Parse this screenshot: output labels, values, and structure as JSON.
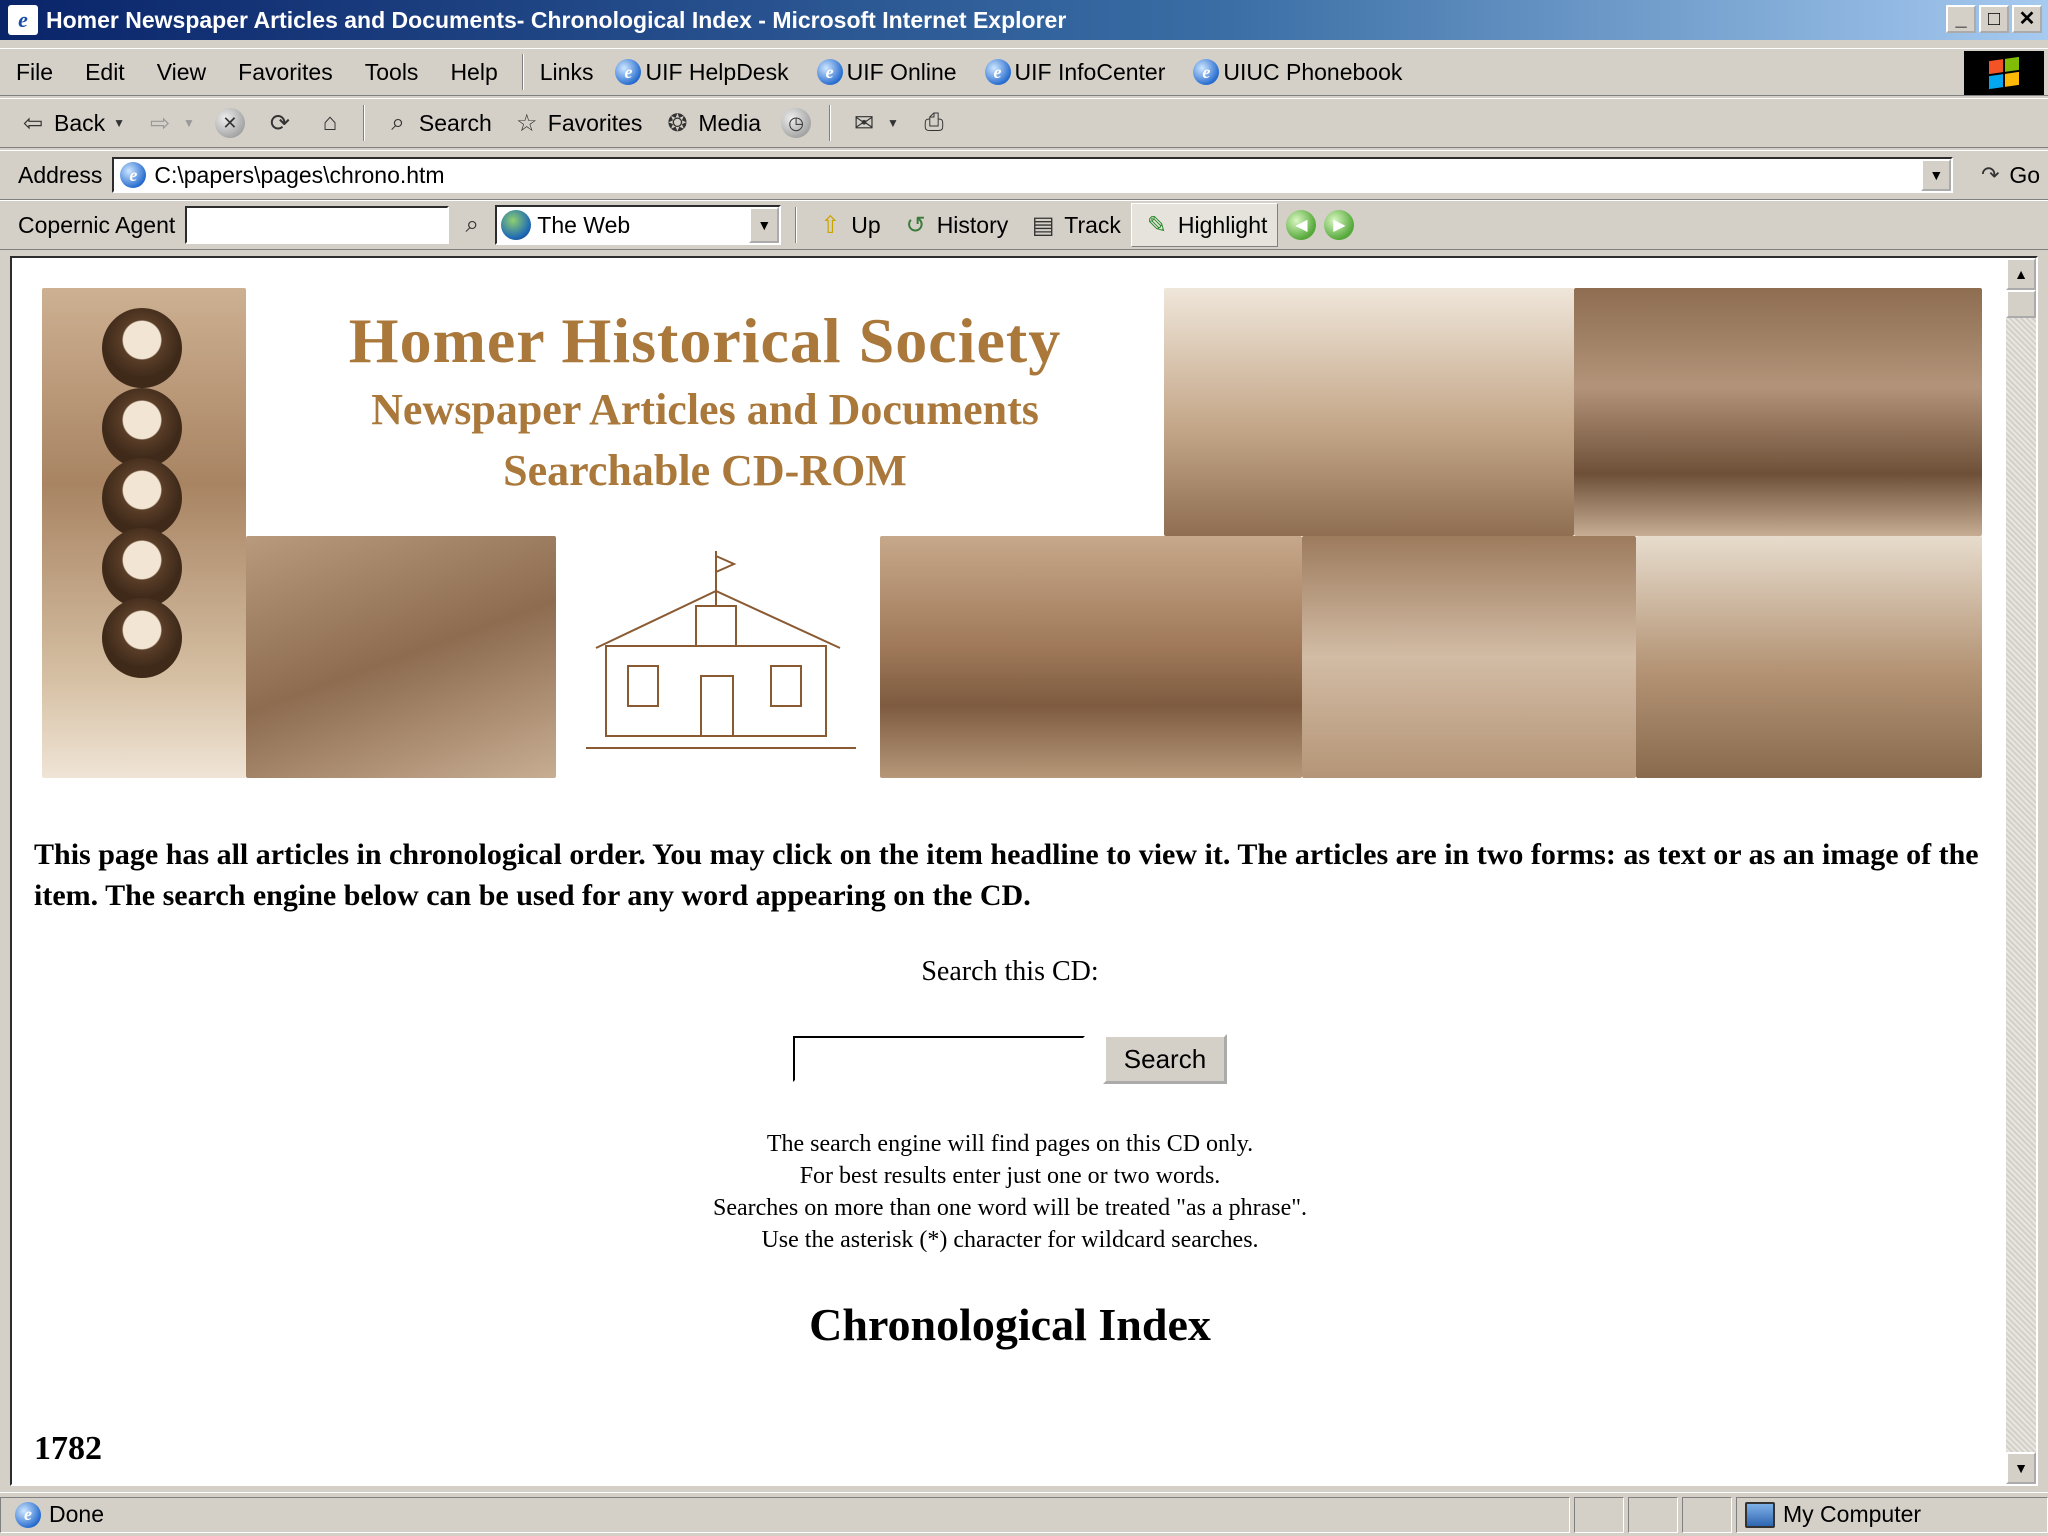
{
  "window": {
    "title": "Homer Newspaper Articles and Documents- Chronological Index - Microsoft Internet Explorer",
    "buttons": [
      "_",
      "□",
      "✕"
    ]
  },
  "menubar": {
    "items": [
      "File",
      "Edit",
      "View",
      "Favorites",
      "Tools",
      "Help"
    ],
    "links_label": "Links",
    "links": [
      "UIF HelpDesk",
      "UIF Online",
      "UIF InfoCenter",
      "UIUC Phonebook"
    ]
  },
  "toolbar": {
    "back": "Back",
    "search": "Search",
    "favorites": "Favorites",
    "media": "Media"
  },
  "addressbar": {
    "label": "Address",
    "url": "C:\\papers\\pages\\chrono.htm",
    "go": "Go"
  },
  "copernic": {
    "label": "Copernic Agent",
    "input_value": "",
    "scope": "The Web",
    "up": "Up",
    "history": "History",
    "track": "Track",
    "highlight": "Highlight"
  },
  "page": {
    "banner": {
      "line1": "Homer Historical Society",
      "line2": "Newspaper Articles and Documents",
      "line3": "Searchable CD-ROM"
    },
    "intro": "This page has all articles in chronological order. You may click on the item headline to view it. The articles are in two forms: as text or as an image of the item. The search engine below can be used for any word appearing on the CD.",
    "search_label": "Search this CD:",
    "search_input_value": "",
    "search_button": "Search",
    "hints": [
      "The search engine will find pages on this CD only.",
      "For best results enter just one or two words.",
      "Searches on more than one word will be treated \"as a phrase\".",
      "Use the asterisk (*) character for wildcard searches."
    ],
    "heading": "Chronological Index",
    "first_year": "1782"
  },
  "statusbar": {
    "status": "Done",
    "zone": "My Computer"
  },
  "colors": {
    "titlebar_start": "#0a246a",
    "banner_text": "#a9783a",
    "chrome": "#d4d0c8"
  }
}
